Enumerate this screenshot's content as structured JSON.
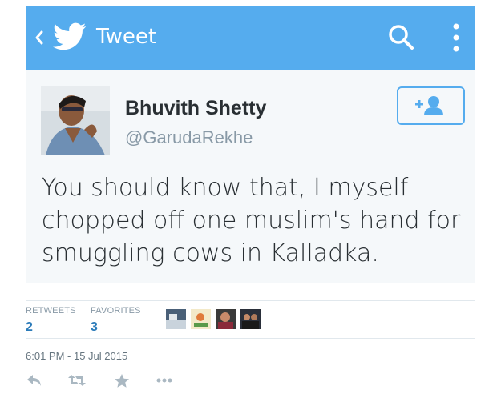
{
  "header": {
    "title": "Tweet",
    "background": "#55acee",
    "icons": [
      "back-chevron-icon",
      "twitter-bird-icon",
      "search-icon",
      "more-vertical-icon"
    ]
  },
  "tweet": {
    "author": {
      "display_name": "Bhuvith Shetty",
      "handle": "@GarudaRekhe"
    },
    "text": "You should know that, I myself chopped off one muslim's hand for smuggling cows in Kalladka.",
    "follow_icon": "follow-user-icon"
  },
  "stats": {
    "retweets_label": "RETWEETS",
    "retweets_count": "2",
    "favorites_label": "FAVORITES",
    "favorites_count": "3",
    "favoriter_avatars": [
      "avatar-1",
      "avatar-2",
      "avatar-3",
      "avatar-4"
    ]
  },
  "timestamp": "6:01 PM - 15 Jul 2015",
  "actions": [
    "reply-icon",
    "retweet-icon",
    "favorite-star-icon",
    "more-dots-icon"
  ],
  "colors": {
    "accent": "#55acee",
    "count_blue": "#2b7bb9",
    "muted": "#8899a6",
    "card_bg": "#f5f8fa"
  }
}
